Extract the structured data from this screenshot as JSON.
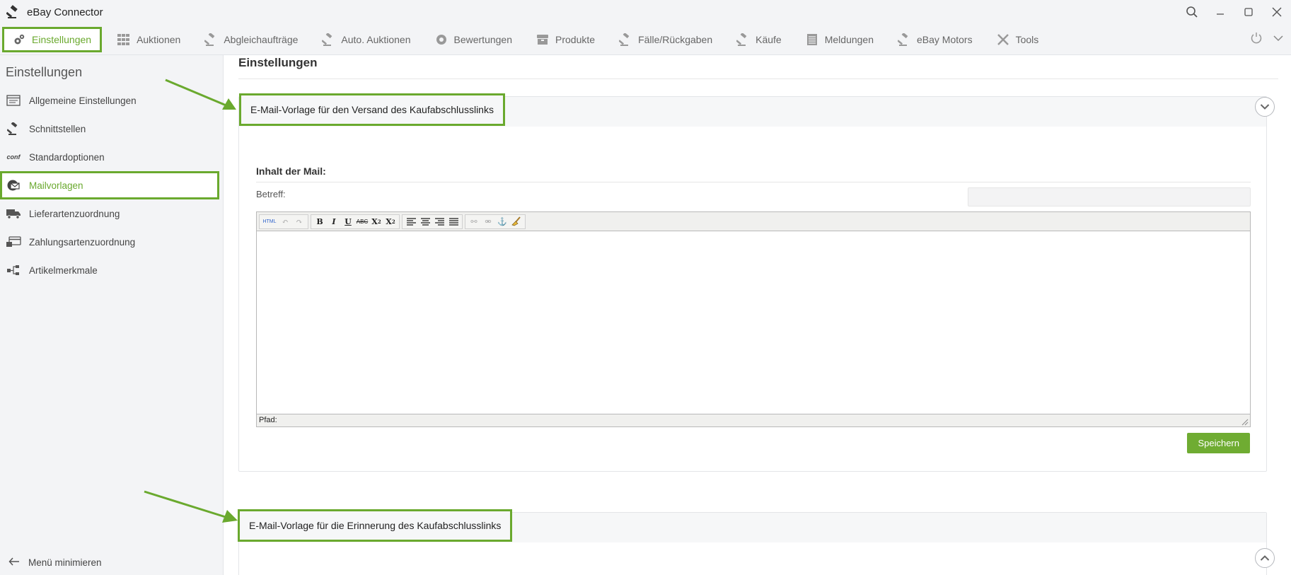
{
  "window": {
    "title": "eBay Connector"
  },
  "menu": {
    "items": [
      {
        "label": "Einstellungen",
        "icon": "gears-icon"
      },
      {
        "label": "Auktionen",
        "icon": "grid-icon"
      },
      {
        "label": "Abgleichaufträge",
        "icon": "gavel-icon"
      },
      {
        "label": "Auto. Auktionen",
        "icon": "gavel-icon"
      },
      {
        "label": "Bewertungen",
        "icon": "gear-icon"
      },
      {
        "label": "Produkte",
        "icon": "box-icon"
      },
      {
        "label": "Fälle/Rückgaben",
        "icon": "gavel-icon"
      },
      {
        "label": "Käufe",
        "icon": "gavel-icon"
      },
      {
        "label": "Meldungen",
        "icon": "notepad-icon"
      },
      {
        "label": "eBay Motors",
        "icon": "gavel-icon"
      },
      {
        "label": "Tools",
        "icon": "tools-icon"
      }
    ]
  },
  "sidebar": {
    "title": "Einstellungen",
    "items": [
      {
        "label": "Allgemeine Einstellungen",
        "icon": "window-icon"
      },
      {
        "label": "Schnittstellen",
        "icon": "gavel-icon"
      },
      {
        "label": "Standardoptionen",
        "icon": "conf-icon",
        "icon_text": "conf"
      },
      {
        "label": "Mailvorlagen",
        "icon": "mail-icon"
      },
      {
        "label": "Lieferartenzuordnung",
        "icon": "truck-icon"
      },
      {
        "label": "Zahlungsartenzuordnung",
        "icon": "payment-icon"
      },
      {
        "label": "Artikelmerkmale",
        "icon": "tree-icon"
      }
    ],
    "minimize_label": "Menü minimieren"
  },
  "main": {
    "title": "Einstellungen",
    "card1": {
      "header": "E-Mail-Vorlage für den Versand des Kaufabschlusslinks",
      "section_label": "Inhalt der Mail:",
      "subject_label": "Betreff:",
      "subject_value": "",
      "editor_status": "Pfad:",
      "save_label": "Speichern"
    },
    "card2": {
      "header": "E-Mail-Vorlage für die Erinnerung des Kaufabschlusslinks"
    }
  },
  "colors": {
    "accent": "#6aa92e",
    "save_button": "#6fac32"
  }
}
